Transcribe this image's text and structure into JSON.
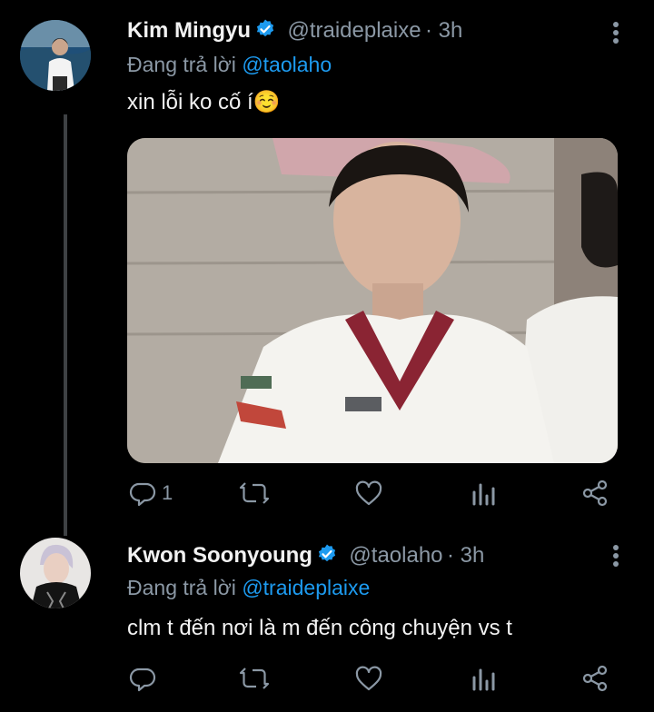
{
  "tweets": [
    {
      "display_name": "Kim Mingyu",
      "handle": "@traideplaixe",
      "time": "· 3h",
      "reply_prefix": "Đang trả lời",
      "reply_to": "@taolaho",
      "text": "xin lỗi ko cố í☺️",
      "reply_count": "1",
      "verified": true
    },
    {
      "display_name": "Kwon Soonyoung",
      "handle": "@taolaho",
      "time": "· 3h",
      "reply_prefix": "Đang trả lời",
      "reply_to": "@traideplaixe",
      "text": "clm t đến nơi là m đến công chuyện vs t",
      "reply_count": "",
      "verified": true
    }
  ],
  "colors": {
    "background": "#000000",
    "verified_badge": "#1d9bf0",
    "mention": "#1d9bf0",
    "muted": "#8b98a5"
  },
  "icons": [
    "more-vertical-icon",
    "verified-badge-icon",
    "reply-icon",
    "retweet-icon",
    "like-icon",
    "analytics-icon",
    "share-icon"
  ]
}
